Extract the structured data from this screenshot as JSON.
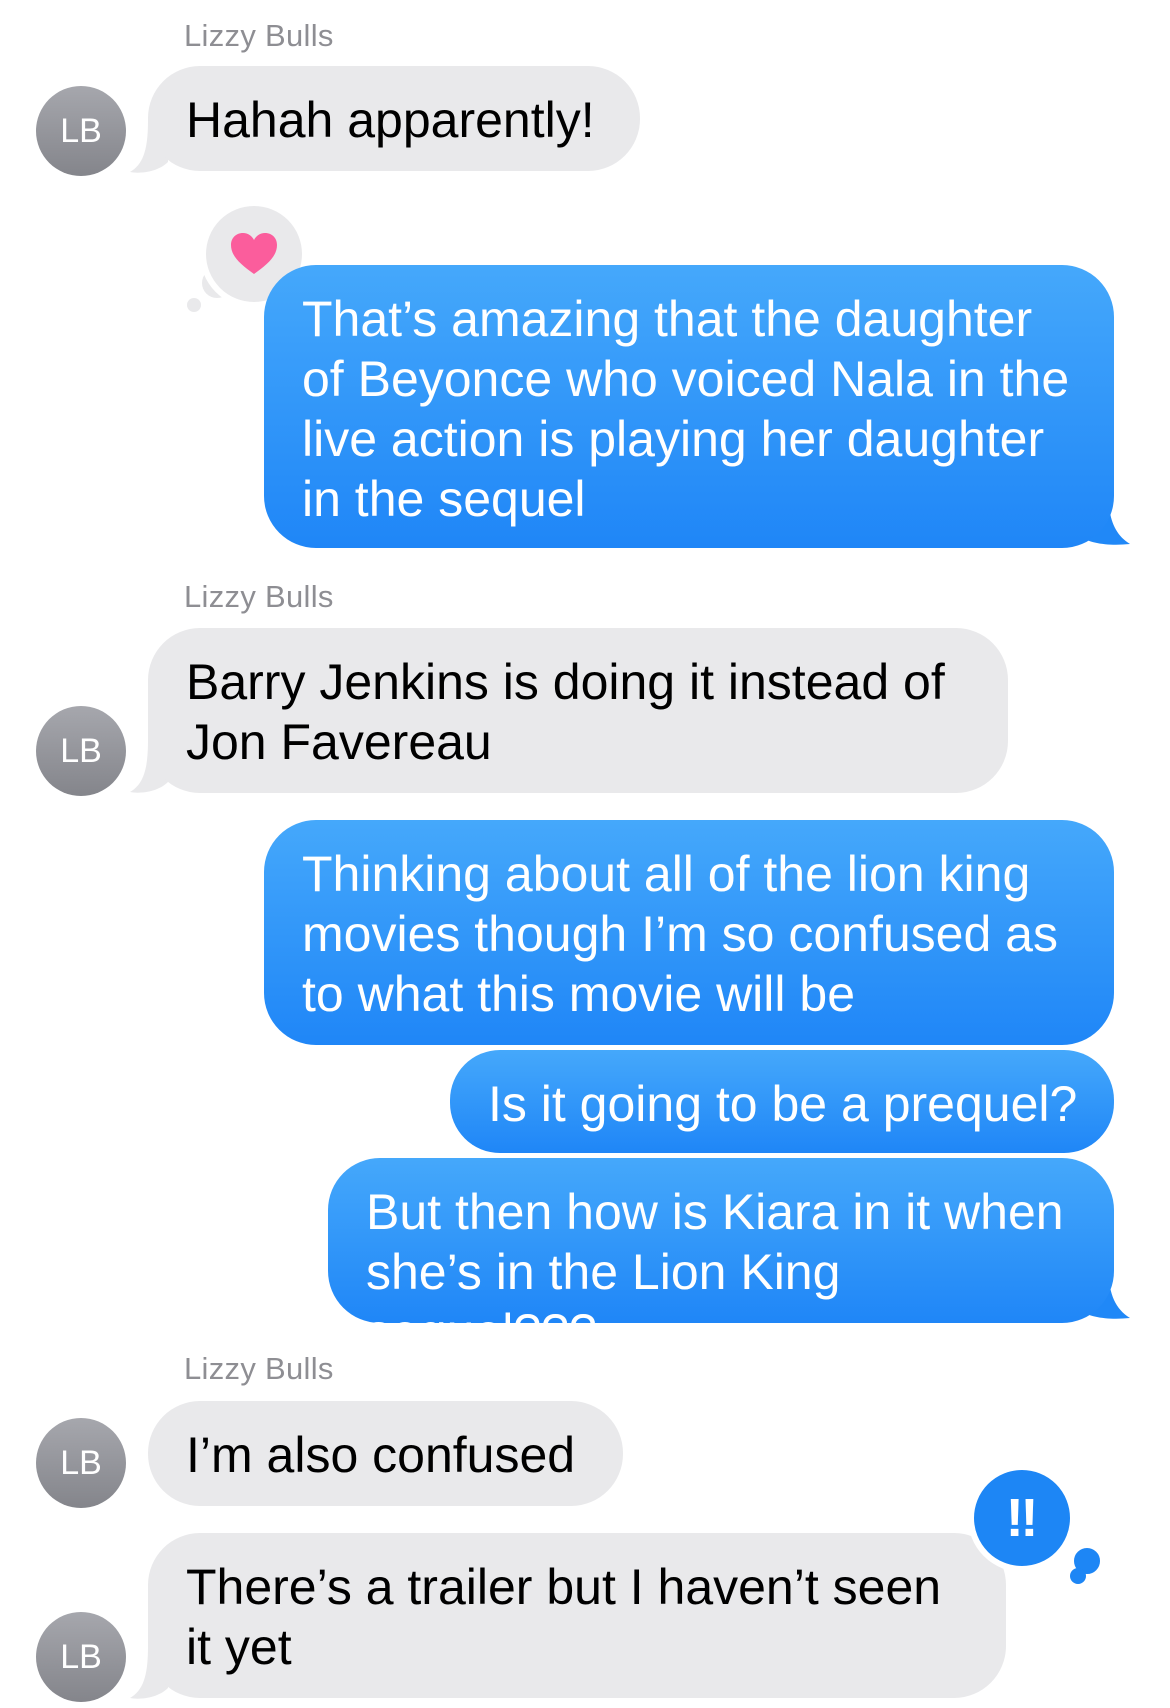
{
  "colors": {
    "incoming_bubble": "#e9e9eb",
    "outgoing_bubble": "#2a91f8",
    "avatar_bg": "#94959b",
    "sender_name": "#8e8e93",
    "heart": "#fb5d9c",
    "tapback_gray": "#e9e9eb",
    "tapback_blue": "#1d86f5"
  },
  "contact": {
    "name": "Lizzy Bulls",
    "initials": "LB"
  },
  "messages": [
    {
      "id": 1,
      "direction": "incoming",
      "text": "Hahah apparently!"
    },
    {
      "id": 2,
      "direction": "outgoing",
      "text": "That’s amazing that the daughter of Beyonce who voiced Nala in the live action is playing her daughter in the sequel",
      "tapback": {
        "icon": "heart-icon"
      }
    },
    {
      "id": 3,
      "direction": "incoming",
      "text": "Barry Jenkins is doing it instead of Jon Favereau"
    },
    {
      "id": 4,
      "direction": "outgoing",
      "text": "Thinking about all of the lion king movies though I’m so confused as to what this movie will be"
    },
    {
      "id": 5,
      "direction": "outgoing",
      "text": "Is it going to be a prequel?"
    },
    {
      "id": 6,
      "direction": "outgoing",
      "text": "But then how is Kiara in it when she’s in the Lion King sequel???"
    },
    {
      "id": 7,
      "direction": "incoming",
      "text": "I’m also confused"
    },
    {
      "id": 8,
      "direction": "incoming",
      "text": "There’s a trailer but I haven’t seen it yet",
      "tapback": {
        "icon": "double-exclamation-icon",
        "text": "‼"
      }
    }
  ]
}
